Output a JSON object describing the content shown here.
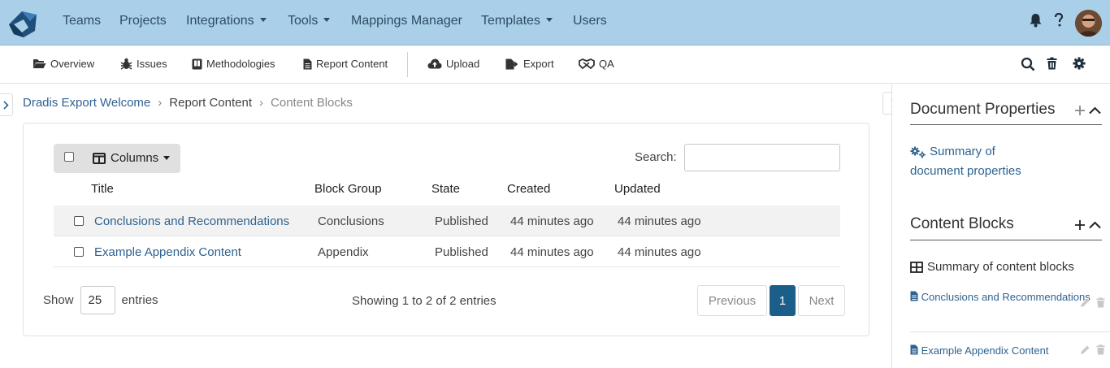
{
  "topnav": {
    "items": [
      {
        "label": "Teams",
        "dropdown": false
      },
      {
        "label": "Projects",
        "dropdown": false
      },
      {
        "label": "Integrations",
        "dropdown": true
      },
      {
        "label": "Tools",
        "dropdown": true
      },
      {
        "label": "Mappings Manager",
        "dropdown": false
      },
      {
        "label": "Templates",
        "dropdown": true
      },
      {
        "label": "Users",
        "dropdown": false
      }
    ],
    "icons": [
      "bell-icon",
      "help-icon",
      "user-avatar"
    ]
  },
  "subnav": {
    "items": [
      {
        "label": "Overview",
        "icon": "folder-open-icon"
      },
      {
        "label": "Issues",
        "icon": "bug-icon"
      },
      {
        "label": "Methodologies",
        "icon": "book-icon"
      },
      {
        "label": "Report Content",
        "icon": "file-icon"
      },
      {
        "label": "Upload",
        "icon": "cloud-upload-icon"
      },
      {
        "label": "Export",
        "icon": "file-export-icon"
      },
      {
        "label": "QA",
        "icon": "handshake-icon"
      }
    ],
    "right_icons": [
      "search-icon",
      "trash-icon",
      "gear-icon"
    ]
  },
  "breadcrumb": {
    "project": "Dradis Export Welcome",
    "section": "Report Content",
    "current": "Content Blocks"
  },
  "table": {
    "columns_button": "Columns",
    "search_label": "Search:",
    "search_value": "",
    "headers": [
      "Title",
      "Block Group",
      "State",
      "Created",
      "Updated"
    ],
    "rows": [
      {
        "title": "Conclusions and Recommendations",
        "block_group": "Conclusions",
        "state": "Published",
        "created": "44 minutes ago",
        "updated": "44 minutes ago"
      },
      {
        "title": "Example Appendix Content",
        "block_group": "Appendix",
        "state": "Published",
        "created": "44 minutes ago",
        "updated": "44 minutes ago"
      }
    ],
    "show_label": "Show",
    "page_length": "25",
    "entries_label": "entries",
    "info": "Showing 1 to 2 of 2 entries",
    "pagination": {
      "previous": "Previous",
      "current": "1",
      "next": "Next"
    }
  },
  "sidebar": {
    "document_properties": {
      "title": "Document Properties",
      "link": "Summary of document properties"
    },
    "content_blocks": {
      "title": "Content Blocks",
      "summary": "Summary of content blocks",
      "items": [
        "Conclusions and Recommendations",
        "Example Appendix Content"
      ]
    }
  },
  "colors": {
    "navbar": "#a9cfe9",
    "link": "#2e6290",
    "active_page": "#1b5e8a"
  }
}
